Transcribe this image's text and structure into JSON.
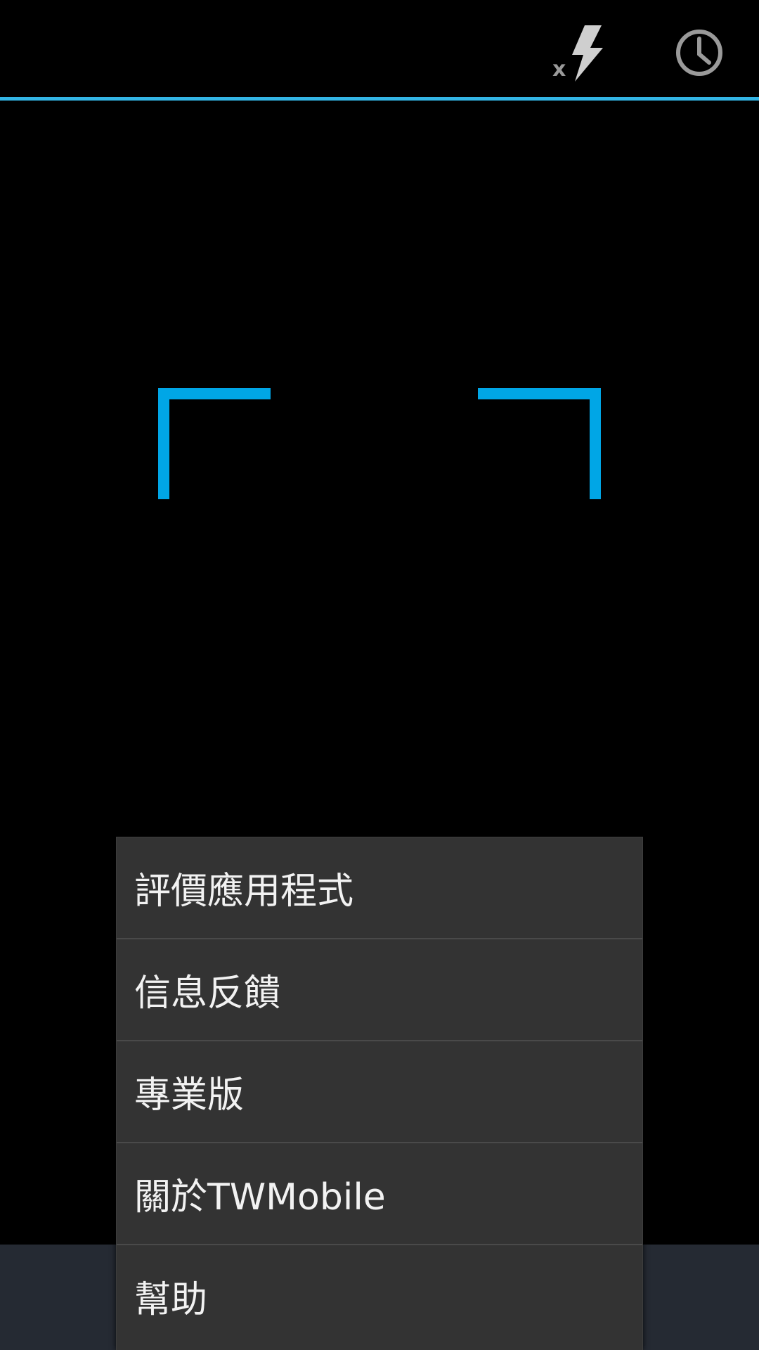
{
  "action_bar": {
    "flash_icon": "flash-off-icon",
    "history_icon": "history-clock-icon"
  },
  "colors": {
    "accent": "#33b5e5",
    "frame": "#00a6e6",
    "menu_bg": "#333333",
    "bottom_bar": "#252a33"
  },
  "menu": {
    "items": [
      {
        "label": "評價應用程式"
      },
      {
        "label": "信息反饋"
      },
      {
        "label": "專業版"
      },
      {
        "label": "關於TWMobile"
      },
      {
        "label": "幫助"
      }
    ]
  }
}
